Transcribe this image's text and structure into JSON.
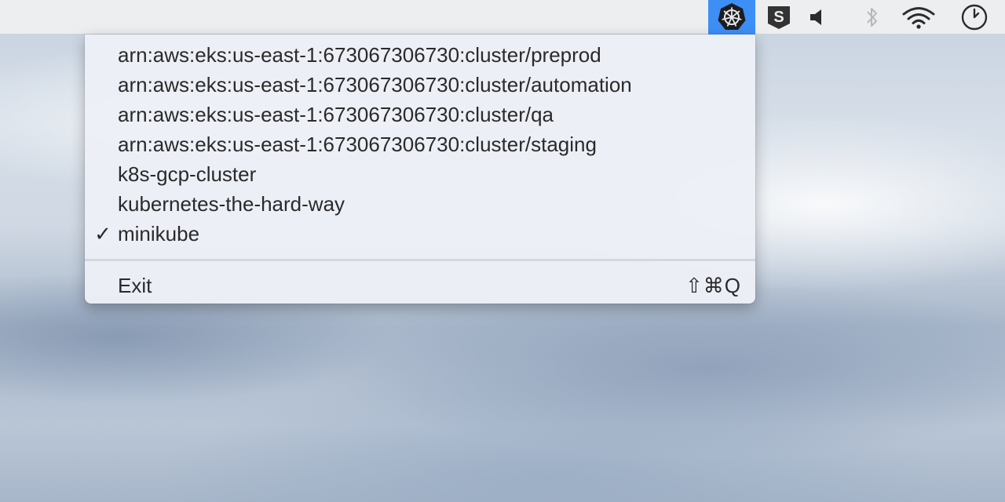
{
  "menubar": {
    "status_items": [
      {
        "name": "kubernetes-icon",
        "active": true,
        "accent": "#3d8ff6"
      },
      {
        "name": "s-app-icon",
        "glyph": "S"
      },
      {
        "name": "volume-icon"
      },
      {
        "name": "bluetooth-icon"
      },
      {
        "name": "wifi-icon"
      },
      {
        "name": "clock-icon"
      }
    ]
  },
  "menu": {
    "items": [
      {
        "label": "arn:aws:eks:us-east-1:673067306730:cluster/preprod",
        "checked": false
      },
      {
        "label": "arn:aws:eks:us-east-1:673067306730:cluster/automation",
        "checked": false
      },
      {
        "label": "arn:aws:eks:us-east-1:673067306730:cluster/qa",
        "checked": false
      },
      {
        "label": "arn:aws:eks:us-east-1:673067306730:cluster/staging",
        "checked": false
      },
      {
        "label": "k8s-gcp-cluster",
        "checked": false
      },
      {
        "label": "kubernetes-the-hard-way",
        "checked": false
      },
      {
        "label": "minikube",
        "checked": true
      }
    ],
    "checkmark": "✓",
    "exit": {
      "label": "Exit",
      "shortcut": "⇧⌘Q"
    }
  }
}
